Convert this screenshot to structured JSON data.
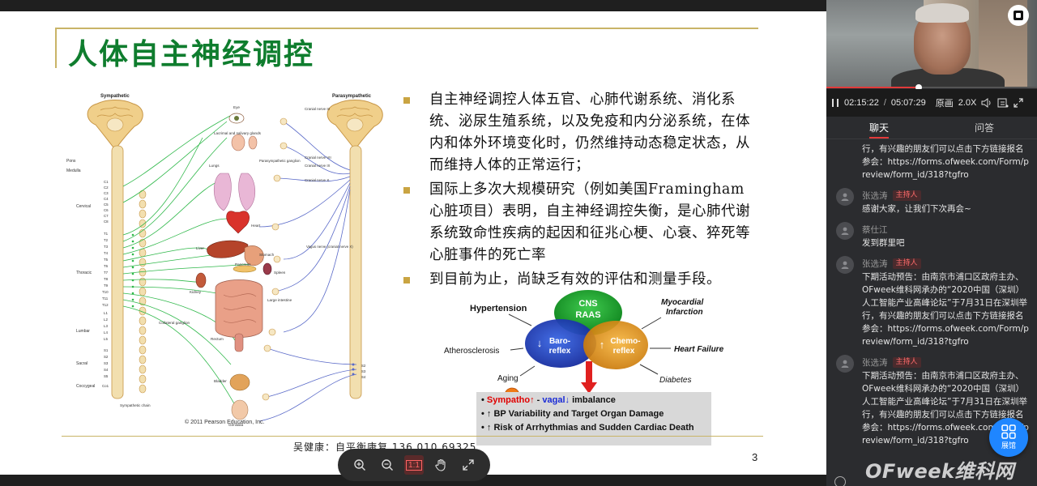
{
  "slide": {
    "title": "人体自主神经调控",
    "bullets": [
      "自主神经调控人体五官、心肺代谢系统、消化系统、泌尿生殖系统，以及免疫和内分泌系统，在体内和体外环境变化时，仍然维持动态稳定状态，从而维持人体的正常运行；",
      "国际上多次大规模研究（例如美国Framingham心脏项目）表明，自主神经调控失衡，是心肺代谢系统致命性疾病的起因和征兆心梗、心衰、猝死等心脏事件的死亡率",
      "到目前为止，尚缺乏有效的评估和测量手段。"
    ],
    "footer": "吴健康：自平衡康复 136 010 69325",
    "page_number": "3",
    "diagram": {
      "sympathetic_label": "Sympathetic",
      "parasympathetic_label": "Parasympathetic",
      "left_labels": [
        "Pons",
        "Medulla",
        "Cervical",
        "Thoracic",
        "Lumbar",
        "Sacral",
        "Coccygeal"
      ],
      "spinal_segments": [
        "C1",
        "C2",
        "C3",
        "C4",
        "C5",
        "C6",
        "C7",
        "C8",
        "T1",
        "T2",
        "T3",
        "T4",
        "T5",
        "T6",
        "T7",
        "T8",
        "T9",
        "T10",
        "T11",
        "T12",
        "L1",
        "L2",
        "L3",
        "L4",
        "L5",
        "S1",
        "S2",
        "S3",
        "S4",
        "S5",
        "Co1"
      ],
      "organ_labels": [
        "Eye",
        "Lacrimal and salivary glands",
        "Lungs",
        "Heart",
        "Liver",
        "Stomach",
        "Pancreas",
        "Spleen",
        "Kidney",
        "Large intestine",
        "Collateral ganglion",
        "Rectum",
        "Bladder",
        "Genitalia",
        "Sympathetic chain"
      ],
      "cranial_labels": [
        "Cranial nerve III",
        "Parasympathetic ganglion",
        "Cranial nerve VII",
        "Cranial nerve IX",
        "Cranial nerve X",
        "Vagus nerve (cranial nerve X)",
        "S2",
        "S3",
        "S4"
      ],
      "copyright": "© 2011 Pearson Education, Inc."
    },
    "venn": {
      "hypertension": "Hypertension",
      "myocardial": "Myocardial",
      "infarction": "Infarction",
      "cns": "CNS",
      "raas": "RAAS",
      "baro_1": "Baro-",
      "baro_2": "reflex",
      "chemo_1": "Chemo-",
      "chemo_2": "reflex",
      "atherosclerosis": "Atherosclerosis",
      "heart_failure": "Heart Failure",
      "aging": "Aging",
      "diabetes": "Diabetes",
      "line1_sympatho": "Sympatho↑",
      "line1_dash": " - ",
      "line1_vagal": "vagal↓",
      "line1_rest": " imbalance",
      "line2": "↑ BP Variability and Target Organ Damage",
      "line3": "↑ Risk of Arrhythmias and Sudden Cardiac Death",
      "colors": {
        "green": "#1a9e2e",
        "blue": "#1b3fbf",
        "orange": "#e59410",
        "arrow": "#e0201f"
      }
    }
  },
  "toolbar": {
    "items": [
      "zoom-in-icon",
      "zoom-out-icon",
      "actual-size-icon",
      "hand-icon",
      "fullscreen-icon"
    ],
    "actual_size_label": "1:1"
  },
  "player": {
    "current_time": "02:15:22",
    "separator": "/",
    "total_time": "05:07:29",
    "quality": "原画",
    "speed": "2.0X",
    "progress_fraction": 0.44
  },
  "tabs": [
    "聊天",
    "问答"
  ],
  "chat": {
    "first_text": "行，有兴趣的朋友们可以点击下方链接报名参会：https://forms.ofweek.com/Form/preview/form_id/318?tgfro",
    "messages": [
      {
        "name": "张选涛",
        "badge": "主持人",
        "text": "感谢大家，让我们下次再会~"
      },
      {
        "name": "蔡仕江",
        "badge": "",
        "text": "发到群里吧"
      },
      {
        "name": "张选涛",
        "badge": "主持人",
        "text": "下期活动预告：由南京市浦口区政府主办、OFweek维科网承办的“2020中国（深圳）人工智能产业高峰论坛”于7月31日在深圳举行，有兴趣的朋友们可以点击下方链接报名参会：https://forms.ofweek.com/Form/preview/form_id/318?tgfro"
      },
      {
        "name": "张选涛",
        "badge": "主持人",
        "text": "下期活动预告：由南京市浦口区政府主办、OFweek维科网承办的“2020中国（深圳）人工智能产业高峰论坛”于7月31日在深圳举行，有兴趣的朋友们可以点击下方链接报名参会：https://forms.ofweek.com/Form/preview/form_id/318?tgfro"
      }
    ]
  },
  "exhibit_label": "展馆",
  "watermark": "OFweek维科网",
  "accent": "#e23a3a"
}
